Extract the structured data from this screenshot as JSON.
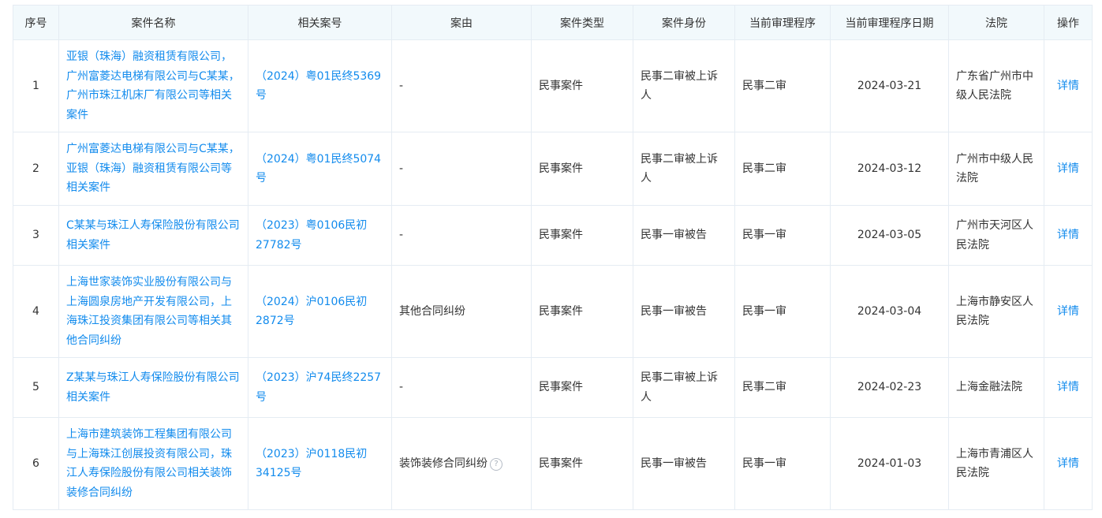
{
  "headers": [
    "序号",
    "案件名称",
    "相关案号",
    "案由",
    "案件类型",
    "案件身份",
    "当前审理程序",
    "当前审理程序日期",
    "法院",
    "操作"
  ],
  "rows": [
    {
      "seq": "1",
      "name": "亚银（珠海）融资租赁有限公司，广州富菱达电梯有限公司与C某某，广州市珠江机床厂有限公司等相关案件",
      "case_no": "（2024）粤01民终5369号",
      "cause": "-",
      "type": "民事案件",
      "identity": "民事二审被上诉人",
      "procedure": "民事二审",
      "date": "2024-03-21",
      "court": "广东省广州市中级人民法院",
      "action": "详情"
    },
    {
      "seq": "2",
      "name": "广州富菱达电梯有限公司与C某某，亚银（珠海）融资租赁有限公司等相关案件",
      "case_no": "（2024）粤01民终5074号",
      "cause": "-",
      "type": "民事案件",
      "identity": "民事二审被上诉人",
      "procedure": "民事二审",
      "date": "2024-03-12",
      "court": "广州市中级人民法院",
      "action": "详情"
    },
    {
      "seq": "3",
      "name": "C某某与珠江人寿保险股份有限公司相关案件",
      "case_no": "（2023）粤0106民初27782号",
      "cause": "-",
      "type": "民事案件",
      "identity": "民事一审被告",
      "procedure": "民事一审",
      "date": "2024-03-05",
      "court": "广州市天河区人民法院",
      "action": "详情"
    },
    {
      "seq": "4",
      "name": "上海世家装饰实业股份有限公司与上海圆泉房地产开发有限公司，上海珠江投资集团有限公司等相关其他合同纠纷",
      "case_no": "（2024）沪0106民初2872号",
      "cause": "其他合同纠纷",
      "type": "民事案件",
      "identity": "民事一审被告",
      "procedure": "民事一审",
      "date": "2024-03-04",
      "court": "上海市静安区人民法院",
      "action": "详情"
    },
    {
      "seq": "5",
      "name": "Z某某与珠江人寿保险股份有限公司相关案件",
      "case_no": "（2023）沪74民终2257号",
      "cause": "-",
      "type": "民事案件",
      "identity": "民事二审被上诉人",
      "procedure": "民事二审",
      "date": "2024-02-23",
      "court": "上海金融法院",
      "action": "详情"
    },
    {
      "seq": "6",
      "name": "上海市建筑装饰工程集团有限公司与上海珠江创展投资有限公司，珠江人寿保险股份有限公司相关装饰装修合同纠纷",
      "case_no": "（2023）沪0118民初34125号",
      "cause": "装饰装修合同纠纷",
      "cause_icon": "?",
      "type": "民事案件",
      "identity": "民事一审被告",
      "procedure": "民事一审",
      "date": "2024-01-03",
      "court": "上海市青浦区人民法院",
      "action": "详情"
    }
  ],
  "colors": {
    "link": "#128bed",
    "header_bg": "#f2f9fc",
    "border": "#e5ecf3",
    "text": "#333333"
  }
}
